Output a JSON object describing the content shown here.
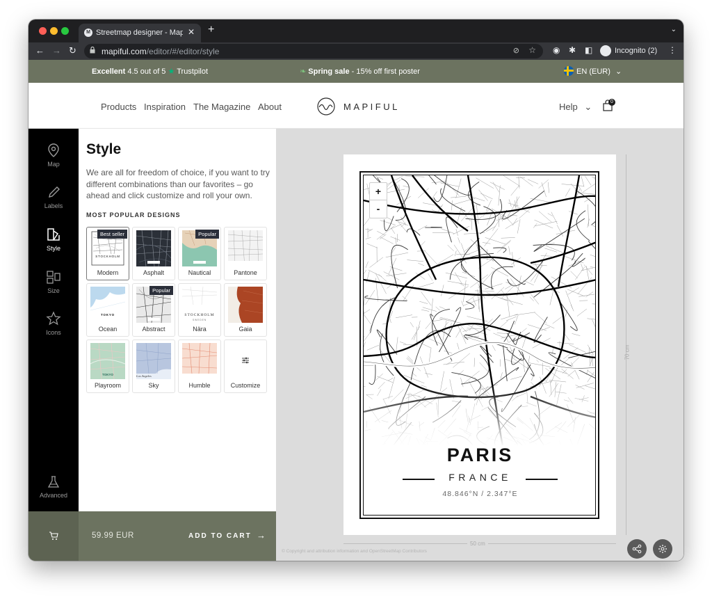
{
  "browser": {
    "tab_title": "Streetmap designer - Mapiful.c",
    "favicon_text": "M",
    "url_host": "mapiful.com",
    "url_path": "/editor/#/editor/style",
    "profile": "Incognito (2)"
  },
  "promo": {
    "rating_bold": "Excellent",
    "rating_rest": "4.5 out of 5",
    "trustpilot": "Trustpilot",
    "sale_bold": "Spring sale",
    "sale_rest": "- 15% off first poster",
    "language": "EN (EUR)"
  },
  "header": {
    "nav": [
      "Products",
      "Inspiration",
      "The Magazine",
      "About"
    ],
    "logo": "MAPIFUL",
    "help": "Help",
    "cart_count": "0"
  },
  "rail": [
    {
      "label": "Map",
      "icon": "map-pin-icon",
      "active": false
    },
    {
      "label": "Labels",
      "icon": "pencil-icon",
      "active": false
    },
    {
      "label": "Style",
      "icon": "style-icon",
      "active": true
    },
    {
      "label": "Size",
      "icon": "size-icon",
      "active": false
    },
    {
      "label": "Icons",
      "icon": "star-icon",
      "active": false
    },
    {
      "label": "Advanced",
      "icon": "flask-icon",
      "active": false
    }
  ],
  "panel": {
    "title": "Style",
    "intro": "We are all for freedom of choice, if you want to try different combinations than our favorites – go ahead and click customize and roll your own.",
    "section": "MOST POPULAR DESIGNS",
    "designs": [
      {
        "name": "Modern",
        "badge": "Best seller",
        "selected": true
      },
      {
        "name": "Asphalt",
        "badge": ""
      },
      {
        "name": "Nautical",
        "badge": "Popular"
      },
      {
        "name": "Pantone",
        "badge": ""
      },
      {
        "name": "Ocean",
        "badge": ""
      },
      {
        "name": "Abstract",
        "badge": "Popular"
      },
      {
        "name": "Nära",
        "badge": ""
      },
      {
        "name": "Gaia",
        "badge": ""
      },
      {
        "name": "Playroom",
        "badge": ""
      },
      {
        "name": "Sky",
        "badge": ""
      },
      {
        "name": "Humble",
        "badge": ""
      },
      {
        "name": "Customize",
        "badge": ""
      }
    ],
    "thumb_labels": {
      "modern": "STOCKHOLM",
      "ocean": "TOKYO",
      "nara_title": "STOCKHOLM",
      "nara_sub": "SWEDEN",
      "playroom": "TOKYO",
      "sky": "Los Angeles"
    }
  },
  "cart": {
    "price": "59.99 EUR",
    "add_label": "ADD TO CART"
  },
  "poster": {
    "city": "PARIS",
    "country": "FRANCE",
    "coords": "48.846°N / 2.347°E",
    "width_label": "50 cm",
    "height_label": "70 cm",
    "zoom_in": "+",
    "zoom_out": "-",
    "copyright": "© Copyright and attribution information and OpenStreetMap Contributors"
  },
  "colors": {
    "brand_olive": "#6c7360",
    "rail_black": "#000000",
    "badge_navy": "#2b2f3a",
    "trustpilot_green": "#00b67a"
  }
}
